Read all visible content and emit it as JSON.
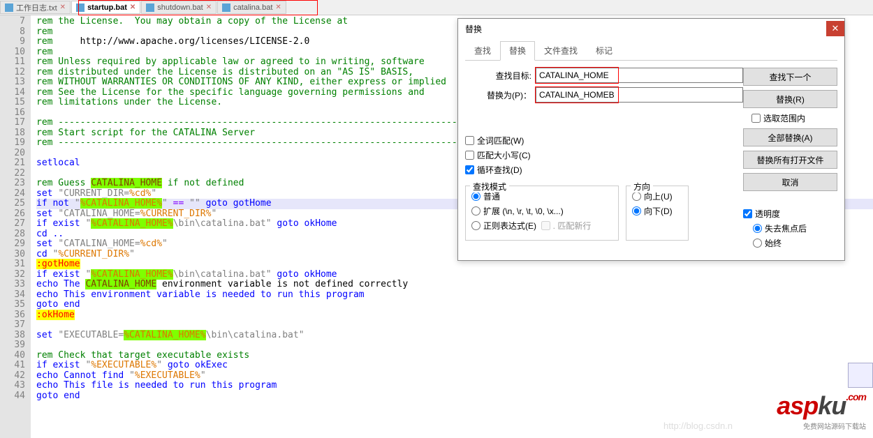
{
  "tabs": [
    {
      "label": "工作日志.txt",
      "active": false
    },
    {
      "label": "startup.bat",
      "active": true
    },
    {
      "label": "shutdown.bat",
      "active": false
    },
    {
      "label": "catalina.bat",
      "active": false
    }
  ],
  "line_start": 7,
  "line_end": 44,
  "code": {
    "l7": "rem the License.  You may obtain a copy of the License at",
    "l8": "rem",
    "l9_a": "rem",
    "l9_b": "     http://www.apache.org/licenses/LICENSE-2.0",
    "l10": "rem",
    "l11": "rem Unless required by applicable law or agreed to in writing, software",
    "l12": "rem distributed under the License is distributed on an \"AS IS\" BASIS,",
    "l13": "rem WITHOUT WARRANTIES OR CONDITIONS OF ANY KIND, either express or implied",
    "l14": "rem See the License for the specific language governing permissions and",
    "l15": "rem limitations under the License.",
    "l17": "rem ---------------------------------------------------------------------------",
    "l18": "rem Start script for the CATALINA Server",
    "l19": "rem ---------------------------------------------------------------------------",
    "l21": "setlocal",
    "l23_a": "rem Guess ",
    "l23_b": "CATALINA_HOME",
    "l23_c": " if not defined",
    "l24_a": "set ",
    "l24_b": "\"CURRENT_DIR=",
    "l24_c": "%cd%",
    "l24_d": "\"",
    "l25_a": "if not ",
    "l25_b": "\"",
    "l25_c": "%CATALINA_HOME%",
    "l25_d": "\"",
    "l25_e": " == ",
    "l25_f": "\"\"",
    "l25_g": " goto gotHome",
    "l26_a": "set ",
    "l26_b": "\"CATALINA_HOME=",
    "l26_c": "%CURRENT_DIR%",
    "l26_d": "\"",
    "l27_a": "if exist ",
    "l27_b": "\"",
    "l27_c": "%CATALINA_HOME%",
    "l27_d": "\\bin\\catalina.bat\"",
    "l27_e": " goto okHome",
    "l28": "cd ..",
    "l29_a": "set ",
    "l29_b": "\"CATALINA_HOME=",
    "l29_c": "%cd%",
    "l29_d": "\"",
    "l30_a": "cd ",
    "l30_b": "\"",
    "l30_c": "%CURRENT_DIR%",
    "l30_d": "\"",
    "l31": ":gotHome",
    "l32_a": "if exist ",
    "l32_b": "\"",
    "l32_c": "%CATALINA_HOME%",
    "l32_d": "\\bin\\catalina.bat\"",
    "l32_e": " goto okHome",
    "l33_a": "echo The ",
    "l33_b": "CATALINA_HOME",
    "l33_c": " environment variable is not defined correctly",
    "l34": "echo This environment variable is needed to run this program",
    "l35": "goto end",
    "l36": ":okHome",
    "l38_a": "set ",
    "l38_b": "\"EXECUTABLE=",
    "l38_c": "%CATALINA_HOME%",
    "l38_d": "\\bin\\catalina.bat\"",
    "l40": "rem Check that target executable exists",
    "l41_a": "if exist ",
    "l41_b": "\"",
    "l41_c": "%EXECUTABLE%",
    "l41_d": "\"",
    "l41_e": " goto okExec",
    "l42_a": "echo Cannot find ",
    "l42_b": "\"",
    "l42_c": "%EXECUTABLE%",
    "l42_d": "\"",
    "l43": "echo This file is needed to run this program",
    "l44": "goto end"
  },
  "dialog": {
    "title": "替换",
    "tabs": [
      "查找",
      "替换",
      "文件查找",
      "标记"
    ],
    "active_tab": 1,
    "find_label": "查找目标:",
    "find_value": "CATALINA_HOME",
    "replace_label": "替换为(P)：",
    "replace_value": "CATALINA_HOMEB",
    "btn_find_next": "查找下一个",
    "btn_replace": "替换(R)",
    "btn_replace_all": "全部替换(A)",
    "btn_replace_all_open": "替换所有打开文件",
    "btn_cancel": "取消",
    "chk_selection": "选取范围内",
    "chk_whole_word": "全词匹配(W)",
    "chk_match_case": "匹配大小写(C)",
    "chk_wrap": "循环查找(D)",
    "grp_mode": "查找模式",
    "mode_normal": "普通",
    "mode_extended": "扩展 (\\n, \\r, \\t, \\0, \\x...)",
    "mode_regex": "正则表达式(E)",
    "mode_regex_nl": ". 匹配新行",
    "grp_direction": "方向",
    "dir_up": "向上(U)",
    "dir_down": "向下(D)",
    "grp_trans": "透明度",
    "trans_focus": "失去焦点后",
    "trans_always": "始终"
  },
  "watermark_url": "http://blog.csdn.n",
  "logo_a": "asp",
  "logo_b": "ku",
  "logo_c": ".com",
  "logo_sub": "免费网站源码下载站"
}
